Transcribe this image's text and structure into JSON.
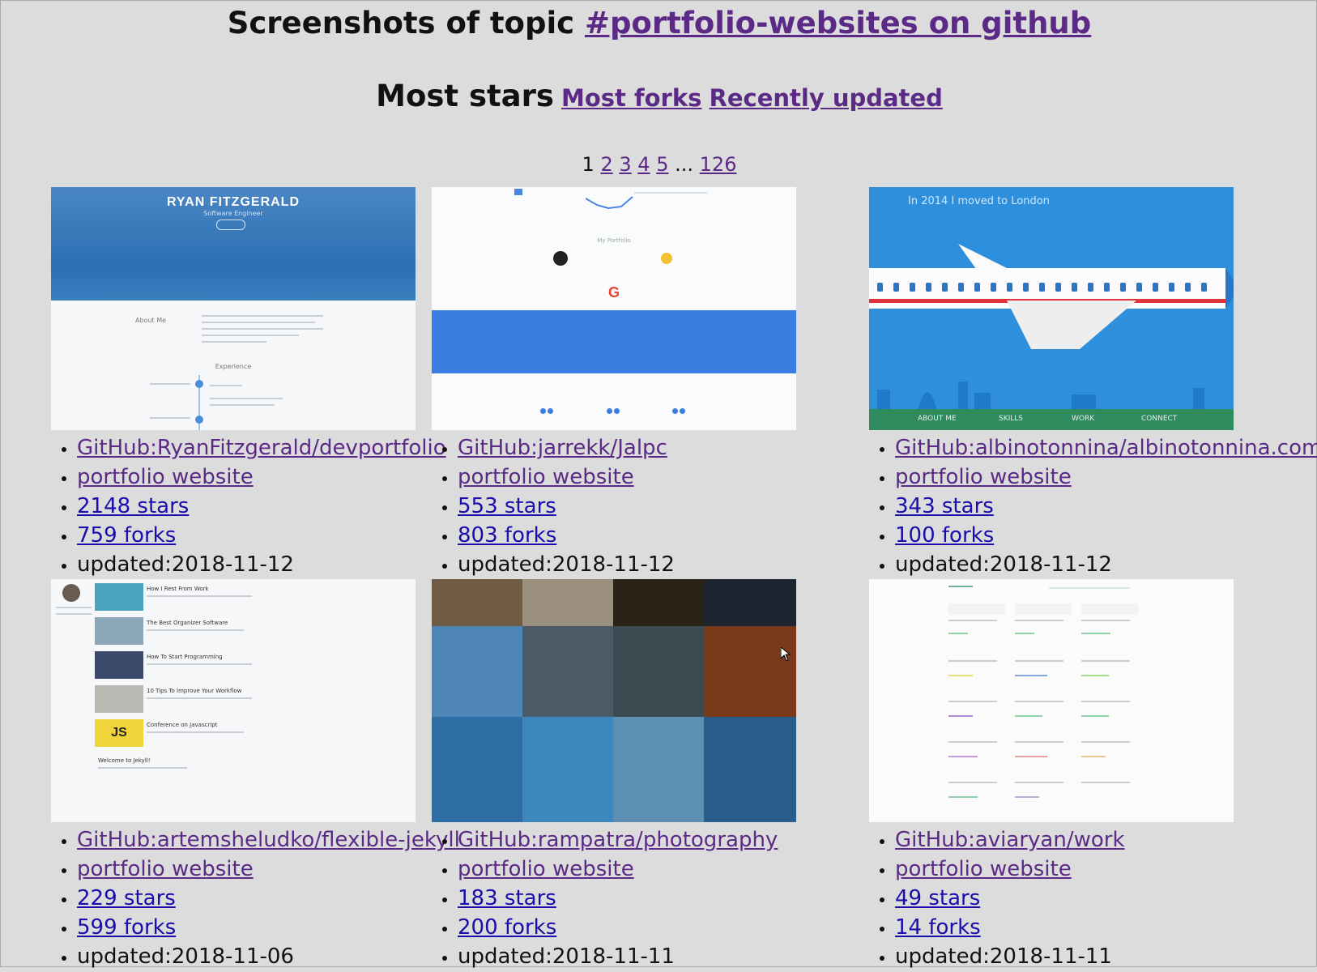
{
  "header": {
    "title_prefix": "Screenshots of topic ",
    "title_link": "#portfolio-websites on github"
  },
  "sort": {
    "current": "Most stars",
    "links": [
      "Most forks",
      "Recently updated"
    ]
  },
  "pager": {
    "current": "1",
    "pages": [
      "2",
      "3",
      "4",
      "5"
    ],
    "ellipsis": "...",
    "last": "126"
  },
  "colors": {
    "background": "#dcdcdc",
    "link": "#1a0dab",
    "visited_link": "#5b2a86"
  },
  "repos": [
    {
      "repo": "GitHub:RyanFitzgerald/devportfolio",
      "desc": "portfolio website",
      "stars": "2148 stars",
      "forks": "759 forks",
      "updated": "updated:2018-11-12",
      "shot": {
        "name": "RYAN FITZGERALD",
        "subtitle": "Software Engineer",
        "section_about": "About Me",
        "section_exp": "Experience"
      }
    },
    {
      "repo": "GitHub:jarrekk/Jalpc",
      "desc": "portfolio website",
      "stars": "553 stars",
      "forks": "803 forks",
      "updated": "updated:2018-11-12",
      "shot": {
        "heading": "My Portfolio"
      }
    },
    {
      "repo": "GitHub:albinotonnina/albinotonnina.com",
      "desc": "portfolio website",
      "stars": "343 stars",
      "forks": "100 forks",
      "updated": "updated:2018-11-12",
      "shot": {
        "caption": "In 2014 I moved to London",
        "nav": [
          "ABOUT ME",
          "SKILLS",
          "WORK",
          "CONNECT"
        ]
      }
    },
    {
      "repo": "GitHub:artemsheludko/flexible-jekyll",
      "desc": "portfolio website",
      "stars": "229 stars",
      "forks": "599 forks",
      "updated": "updated:2018-11-06",
      "shot": {
        "posts": [
          "How I Rest From Work",
          "The Best Organizer Software",
          "How To Start Programming",
          "10 Tips To Improve Your Workflow",
          "Conference on Javascript"
        ],
        "welcome": "Welcome to Jekyll!",
        "js_badge": "JS"
      }
    },
    {
      "repo": "GitHub:rampatra/photography",
      "desc": "portfolio website",
      "stars": "183 stars",
      "forks": "200 forks",
      "updated": "updated:2018-11-11"
    },
    {
      "repo": "GitHub:aviaryan/work",
      "desc": "portfolio website",
      "stars": "49 stars",
      "forks": "14 forks",
      "updated": "updated:2018-11-11"
    }
  ]
}
